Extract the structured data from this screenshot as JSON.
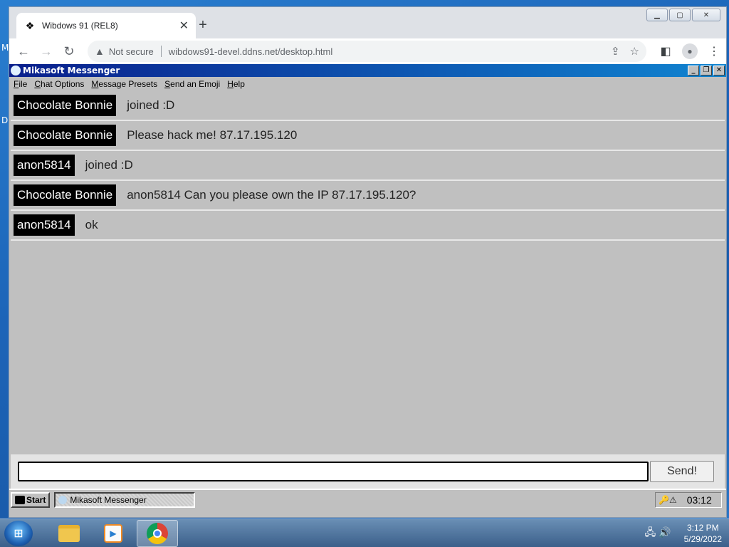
{
  "desktop_fragments": [
    "M",
    "D"
  ],
  "browser": {
    "tab_title": "Wibdows 91 (REL8)",
    "tab_close": "✕",
    "new_tab": "+",
    "not_secure": "Not secure",
    "url": "wibdows91-devel.ddns.net/desktop.html"
  },
  "app": {
    "title": "Mikasoft Messenger",
    "menu": [
      {
        "ul": "F",
        "rest": "ile"
      },
      {
        "ul": "C",
        "rest": "hat Options"
      },
      {
        "ul": "M",
        "rest": "essage Presets"
      },
      {
        "ul": "S",
        "rest": "end an Emoji"
      },
      {
        "ul": "H",
        "rest": "elp"
      }
    ],
    "messages": [
      {
        "user": "Chocolate Bonnie",
        "text": "joined :D"
      },
      {
        "user": "Chocolate Bonnie",
        "text": "Please hack me! 87.17.195.120"
      },
      {
        "user": "anon5814",
        "text": "joined :D"
      },
      {
        "user": "Chocolate Bonnie",
        "text": "anon5814 Can you please own the IP 87.17.195.120?"
      },
      {
        "user": "anon5814",
        "text": "ok"
      }
    ],
    "input_value": "",
    "send_label": "Send!"
  },
  "wibdows_taskbar": {
    "start_label": "Start",
    "task_label": "Mikasoft Messenger",
    "clock": "03:12"
  },
  "win7_taskbar": {
    "time": "3:12 PM",
    "date": "5/29/2022"
  }
}
